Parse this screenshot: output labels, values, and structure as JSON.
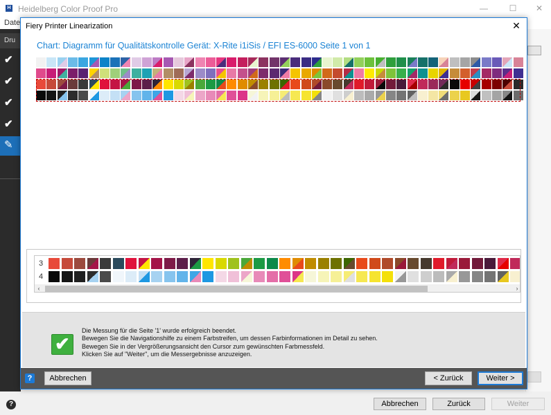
{
  "app": {
    "title": "Heidelberg Color Proof Pro",
    "logo_letter": "H",
    "menu": [
      "Datei"
    ],
    "sidebar_tab": "Dru",
    "window_controls": [
      "—",
      "☐",
      "✕"
    ]
  },
  "dialog": {
    "title": "Fiery Printer Linearization",
    "close": "✕",
    "heading": "Chart: Diagramm für Qualitätskontrolle  Gerät: X-Rite i1iSis / EFI ES-6000  Seite 1 von 1",
    "zoom_rows": [
      "3",
      "4"
    ],
    "scroll_left": "‹",
    "scroll_right": "›",
    "message_lines": [
      "Die Messung für die Seite '1' wurde erfolgreich beendet.",
      "Bewegen Sie die Navigationshilfe zu einem Farbstreifen, um dessen Farbinformationen im Detail zu sehen.",
      "Bewegen Sie in der Vergrößerungsansicht den Cursor zum gewünschten Farbmessfeld.",
      "Klicken Sie auf \"Weiter\", um die Messergebnisse anzuzeigen."
    ],
    "buttons": {
      "help": "?",
      "cancel": "Abbrechen",
      "back": "< Zurück",
      "next": "Weiter >"
    }
  },
  "footer": {
    "help": "?",
    "cancel": "Abbrechen",
    "back": "Zurück",
    "next": "Weiter"
  },
  "colors": {
    "accent": "#1c7ad6",
    "heading": "#1b83d4",
    "selection": "#c00000",
    "success": "#3fb03f"
  },
  "icons": {
    "check": "✔",
    "pencil": "✎",
    "success": "✔"
  }
}
